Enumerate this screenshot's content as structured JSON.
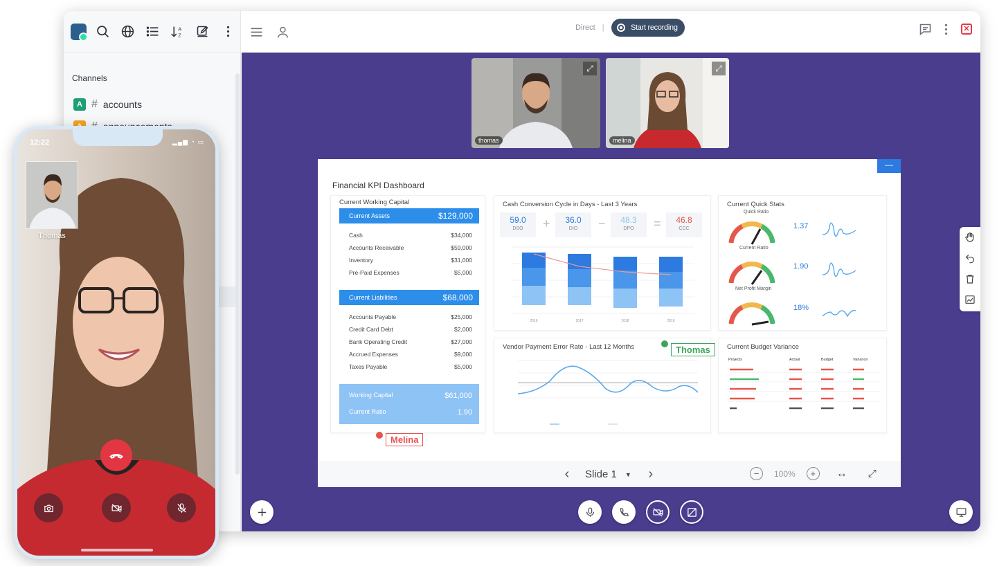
{
  "sidebar": {
    "section_title": "Channels",
    "channels": [
      {
        "avatar": "A",
        "avatar_color": "#1d9e74",
        "name": "accounts"
      },
      {
        "avatar": "A",
        "avatar_color": "#f5a623",
        "name": "announcements"
      }
    ],
    "toolbar_icons": [
      "workspace-logo",
      "search-icon",
      "globe-icon",
      "list-icon",
      "sort-icon",
      "edit-icon",
      "kebab-icon"
    ]
  },
  "header": {
    "room_type": "Direct",
    "recording_label": "Start recording"
  },
  "video_tiles": [
    {
      "name": "thomas"
    },
    {
      "name": "melina"
    }
  ],
  "dashboard": {
    "title": "Financial KPI Dashboard",
    "working_capital": {
      "title": "Current Working Capital",
      "assets_label": "Current Assets",
      "assets_total": "$129,000",
      "assets": [
        {
          "label": "Cash",
          "value": "$34,000"
        },
        {
          "label": "Accounts Receivable",
          "value": "$59,000"
        },
        {
          "label": "Inventory",
          "value": "$31,000"
        },
        {
          "label": "Pre-Paid Expenses",
          "value": "$5,000"
        }
      ],
      "liabilities_label": "Current Liabilities",
      "liabilities_total": "$68,000",
      "liabilities": [
        {
          "label": "Accounts Payable",
          "value": "$25,000"
        },
        {
          "label": "Credit Card Debt",
          "value": "$2,000"
        },
        {
          "label": "Bank Operating Credit",
          "value": "$27,000"
        },
        {
          "label": "Accrued Expenses",
          "value": "$9,000"
        },
        {
          "label": "Taxes Payable",
          "value": "$5,000"
        }
      ],
      "wc_label": "Working Capital",
      "wc_value": "$61,000",
      "ratio_label": "Current Ratio",
      "ratio_value": "1.90"
    },
    "ccc": {
      "title": "Cash Conversion Cycle in Days - Last 3 Years",
      "boxes": [
        {
          "value": "59.0",
          "label": "DSO"
        },
        {
          "value": "36.0",
          "label": "DIO"
        },
        {
          "value": "48.3",
          "label": "DPO"
        },
        {
          "value": "46.8",
          "label": "CCC"
        }
      ],
      "operators": [
        "+",
        "−",
        "="
      ],
      "years": [
        "2016",
        "2017",
        "2018",
        "2016"
      ]
    },
    "quick_stats": {
      "title": "Current Quick Stats",
      "items": [
        {
          "label": "Quick Ratio",
          "value": "1.37"
        },
        {
          "label": "Current Ratio",
          "value": "1.90"
        },
        {
          "label": "Net Profit Margin",
          "value": "18%"
        }
      ]
    },
    "vendor": {
      "title": "Vendor Payment Error Rate - Last 12 Months"
    },
    "budget": {
      "title": "Current Budget Variance",
      "headers": [
        "Projects",
        "Actual",
        "Budget",
        "Variance"
      ]
    },
    "cursors": [
      {
        "name": "Thomas",
        "color": "#3aa65a"
      },
      {
        "name": "Melina",
        "color": "#e55353"
      }
    ]
  },
  "slide_controls": {
    "label": "Slide 1",
    "zoom": "100%"
  },
  "phone": {
    "time": "12:22",
    "pip_name": "Thomas"
  },
  "colors": {
    "stage": "#4a3d8e",
    "accent_blue": "#2d8eea",
    "end_call": "#e23742",
    "recording_pill": "#3a4d66"
  }
}
